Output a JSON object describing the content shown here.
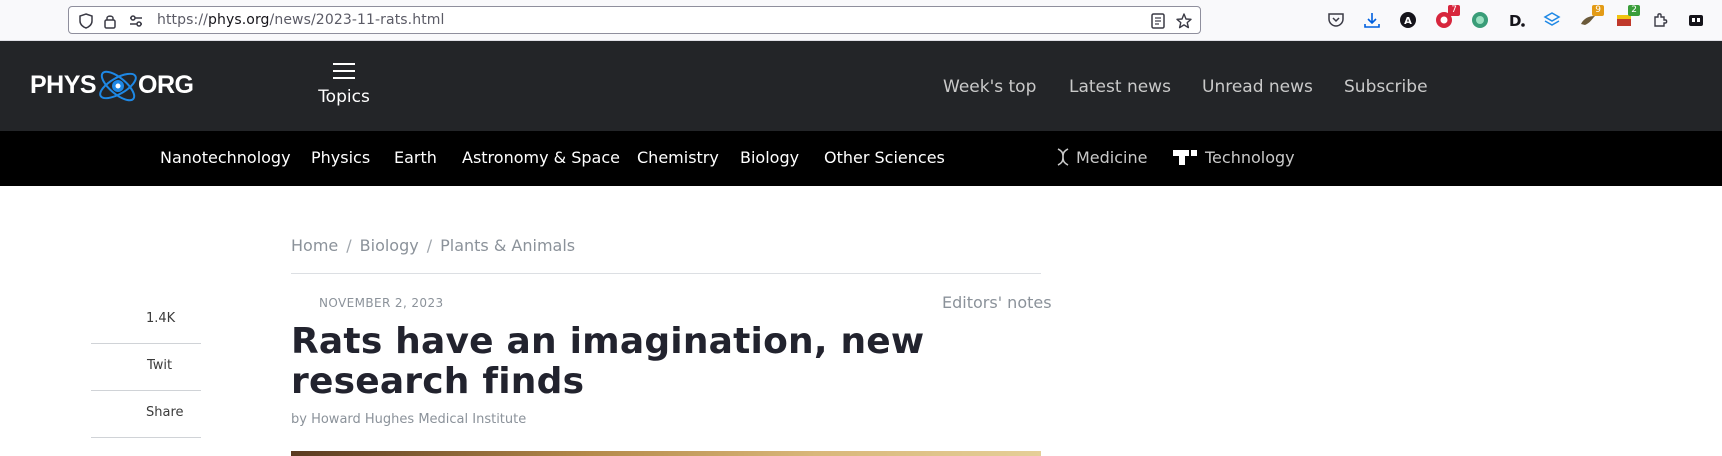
{
  "browser": {
    "url_prefix": "https://",
    "url_host": "phys.org",
    "url_path": "/news/2023-11-rats.html",
    "extensions": [
      {
        "name": "pocket-icon",
        "badge": ""
      },
      {
        "name": "download-icon",
        "badge": ""
      },
      {
        "name": "account-icon",
        "badge": ""
      },
      {
        "name": "extension-red-icon",
        "badge": "7"
      },
      {
        "name": "extension-green-icon",
        "badge": ""
      },
      {
        "name": "extension-d-icon",
        "badge": ""
      },
      {
        "name": "extension-layers-icon",
        "badge": ""
      },
      {
        "name": "extension-bird-icon",
        "badge": "9"
      },
      {
        "name": "extension-flag-icon",
        "badge": "2"
      },
      {
        "name": "extensions-puzzle-icon",
        "badge": ""
      },
      {
        "name": "container-icon",
        "badge": ""
      }
    ],
    "colors": {
      "badge_red": "#d7263d",
      "badge_orange": "#e39b16",
      "badge_green": "#3a9d3a",
      "accent_blue": "#0060df"
    }
  },
  "header": {
    "logo_left": "PHYS",
    "logo_right": "ORG",
    "topics_label": "Topics",
    "nav": [
      "Week's top",
      "Latest news",
      "Unread news",
      "Subscribe"
    ]
  },
  "categories": {
    "main": [
      "Nanotechnology",
      "Physics",
      "Earth",
      "Astronomy & Space",
      "Chemistry",
      "Biology",
      "Other Sciences"
    ],
    "external": [
      "Medicine",
      "Technology"
    ]
  },
  "article": {
    "breadcrumb": [
      "Home",
      "Biology",
      "Plants & Animals"
    ],
    "date": "NOVEMBER 2, 2023",
    "editors_notes": "Editors' notes",
    "title": "Rats have an imagination, new research finds",
    "byline": "by Howard Hughes Medical Institute"
  },
  "share": {
    "count": "1.4K",
    "tweet": "Twit",
    "share": "Share"
  }
}
